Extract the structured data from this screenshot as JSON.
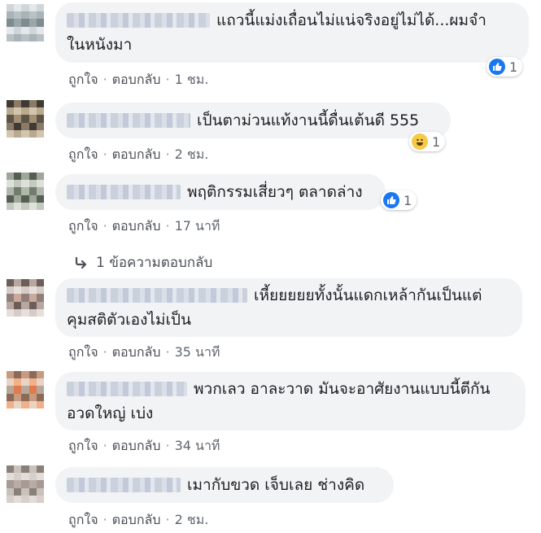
{
  "actions": {
    "like": "ถูกใจ",
    "reply": "ตอบกลับ",
    "sep": "·"
  },
  "comments": [
    {
      "lines": [
        "แถวนี้แม่งเถื่อนไม่แน่จริงอยู่ไม่ได้...ผมจำ",
        "ในหนังมา"
      ],
      "time": "1 ชม.",
      "reaction": {
        "icon": "like-icon",
        "count": "1"
      }
    },
    {
      "lines": [
        "เป็นตาม่วนแท้งานนี้ดื่นเต้นดี 555"
      ],
      "time": "2 ชม.",
      "reaction": {
        "icon": "haha-icon",
        "count": "1"
      }
    },
    {
      "lines": [
        "พฤติกรรมเสี่ยวๆ ตลาดล่าง"
      ],
      "time": "17 นาที",
      "reaction": {
        "icon": "like-icon",
        "count": "1"
      }
    },
    {
      "lines": [
        "เหี้ยยยยยทั้งนั้นแดกเหล้ากันเป็นแต่",
        "คุมสติตัวเองไม่เป็น"
      ],
      "time": "35 นาที"
    },
    {
      "lines": [
        "พวกเลว อาละวาด มันจะอาศัยงานแบบนี้ตีกัน",
        "อวดใหญ่ เบ่ง"
      ],
      "time": "34 นาที"
    },
    {
      "lines": [
        "เมากับขวด เจ็บเลย ช่างคิด"
      ],
      "time": "2 ชม."
    }
  ],
  "replies_link": "1 ข้อความตอบกลับ",
  "colors": {
    "bubble": "#f2f3f5",
    "like": "#1877f2",
    "haha": "#f7c948",
    "meta": "#606770"
  }
}
